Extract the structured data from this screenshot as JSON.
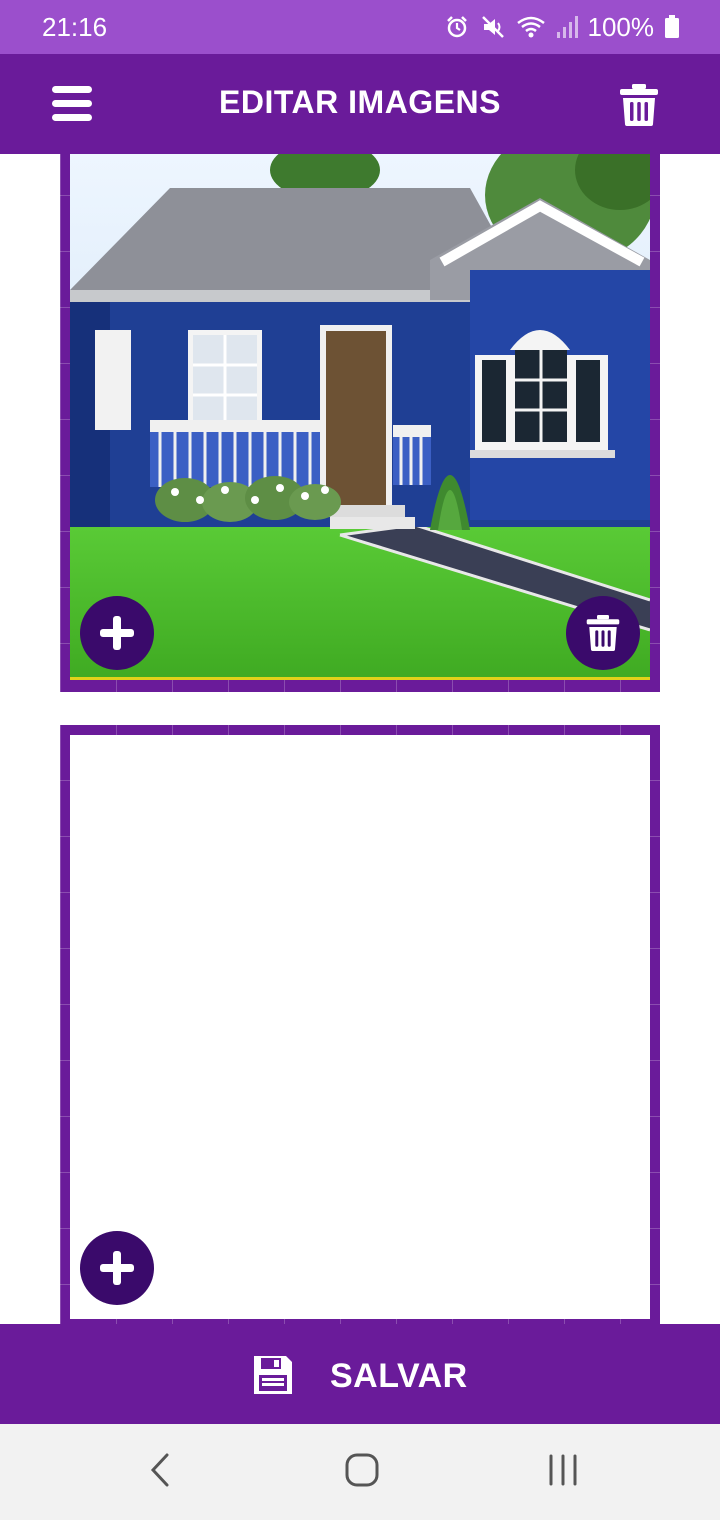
{
  "status_bar": {
    "time": "21:16",
    "battery": "100%",
    "icons": [
      "alarm-icon",
      "mute-icon",
      "wifi-icon",
      "signal-icon",
      "battery-icon"
    ]
  },
  "app_bar": {
    "title": "EDITAR IMAGENS",
    "left_icon": "menu-icon",
    "right_icon": "trash-icon"
  },
  "cards": [
    {
      "has_image": true,
      "image": "house-photo",
      "add_icon": "plus-icon",
      "delete_icon": "trash-icon"
    },
    {
      "has_image": false,
      "add_icon": "plus-icon"
    }
  ],
  "bottom_bar": {
    "save_label": "SALVAR",
    "save_icon": "floppy-disk-icon"
  },
  "nav_bar": {
    "icons": [
      "back-icon",
      "home-icon",
      "recents-icon"
    ]
  },
  "colors": {
    "status_bar": "#9b4fcc",
    "primary": "#6a1b9a",
    "fab": "#3a0a6b",
    "nav_bar": "#f2f2f2"
  }
}
